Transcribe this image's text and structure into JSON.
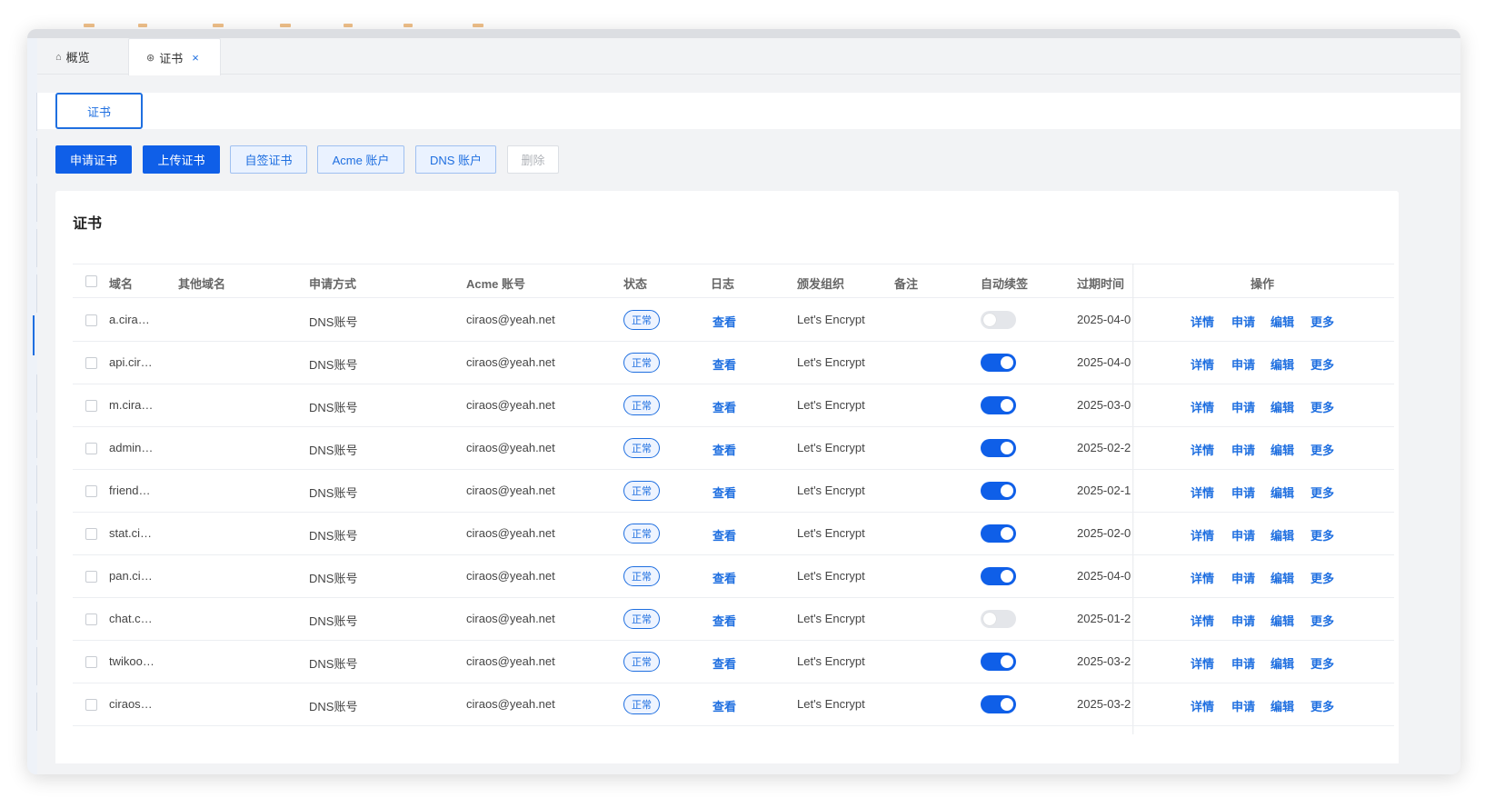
{
  "tabs": [
    {
      "label": "概览",
      "icon": "home-icon"
    },
    {
      "label": "证书",
      "icon": "cert-icon",
      "close": "×"
    }
  ],
  "filter": {
    "label": "证书"
  },
  "toolbar": {
    "apply": "申请证书",
    "upload": "上传证书",
    "selfsigned": "自签证书",
    "acme": "Acme 账户",
    "dns": "DNS 账户",
    "delete": "删除"
  },
  "panel": {
    "title": "证书"
  },
  "columns": {
    "domain": "域名",
    "other": "其他域名",
    "method": "申请方式",
    "acme": "Acme 账号",
    "status": "状态",
    "log": "日志",
    "issuer": "颁发组织",
    "note": "备注",
    "renew": "自动续签",
    "expire": "过期时间",
    "ops": "操作"
  },
  "ops": {
    "detail": "详情",
    "apply": "申请",
    "edit": "编辑",
    "more": "更多"
  },
  "colors": {
    "primary": "#0f5fe8",
    "link": "#1f6fe0"
  },
  "rows": [
    {
      "domain": "a.cira…",
      "method": "DNS账号",
      "acme": "ciraos@yeah.net",
      "status": "正常",
      "log": "查看",
      "issuer": "Let's Encrypt",
      "renew": false,
      "expire": "2025-04-0"
    },
    {
      "domain": "api.cir…",
      "method": "DNS账号",
      "acme": "ciraos@yeah.net",
      "status": "正常",
      "log": "查看",
      "issuer": "Let's Encrypt",
      "renew": true,
      "expire": "2025-04-0"
    },
    {
      "domain": "m.cira…",
      "method": "DNS账号",
      "acme": "ciraos@yeah.net",
      "status": "正常",
      "log": "查看",
      "issuer": "Let's Encrypt",
      "renew": true,
      "expire": "2025-03-0"
    },
    {
      "domain": "admin…",
      "method": "DNS账号",
      "acme": "ciraos@yeah.net",
      "status": "正常",
      "log": "查看",
      "issuer": "Let's Encrypt",
      "renew": true,
      "expire": "2025-02-2"
    },
    {
      "domain": "friend…",
      "method": "DNS账号",
      "acme": "ciraos@yeah.net",
      "status": "正常",
      "log": "查看",
      "issuer": "Let's Encrypt",
      "renew": true,
      "expire": "2025-02-1"
    },
    {
      "domain": "stat.ci…",
      "method": "DNS账号",
      "acme": "ciraos@yeah.net",
      "status": "正常",
      "log": "查看",
      "issuer": "Let's Encrypt",
      "renew": true,
      "expire": "2025-02-0"
    },
    {
      "domain": "pan.ci…",
      "method": "DNS账号",
      "acme": "ciraos@yeah.net",
      "status": "正常",
      "log": "查看",
      "issuer": "Let's Encrypt",
      "renew": true,
      "expire": "2025-04-0"
    },
    {
      "domain": "chat.c…",
      "method": "DNS账号",
      "acme": "ciraos@yeah.net",
      "status": "正常",
      "log": "查看",
      "issuer": "Let's Encrypt",
      "renew": false,
      "expire": "2025-01-2"
    },
    {
      "domain": "twikoo…",
      "method": "DNS账号",
      "acme": "ciraos@yeah.net",
      "status": "正常",
      "log": "查看",
      "issuer": "Let's Encrypt",
      "renew": true,
      "expire": "2025-03-2"
    },
    {
      "domain": "ciraos…",
      "method": "DNS账号",
      "acme": "ciraos@yeah.net",
      "status": "正常",
      "log": "查看",
      "issuer": "Let's Encrypt",
      "renew": true,
      "expire": "2025-03-2"
    }
  ]
}
